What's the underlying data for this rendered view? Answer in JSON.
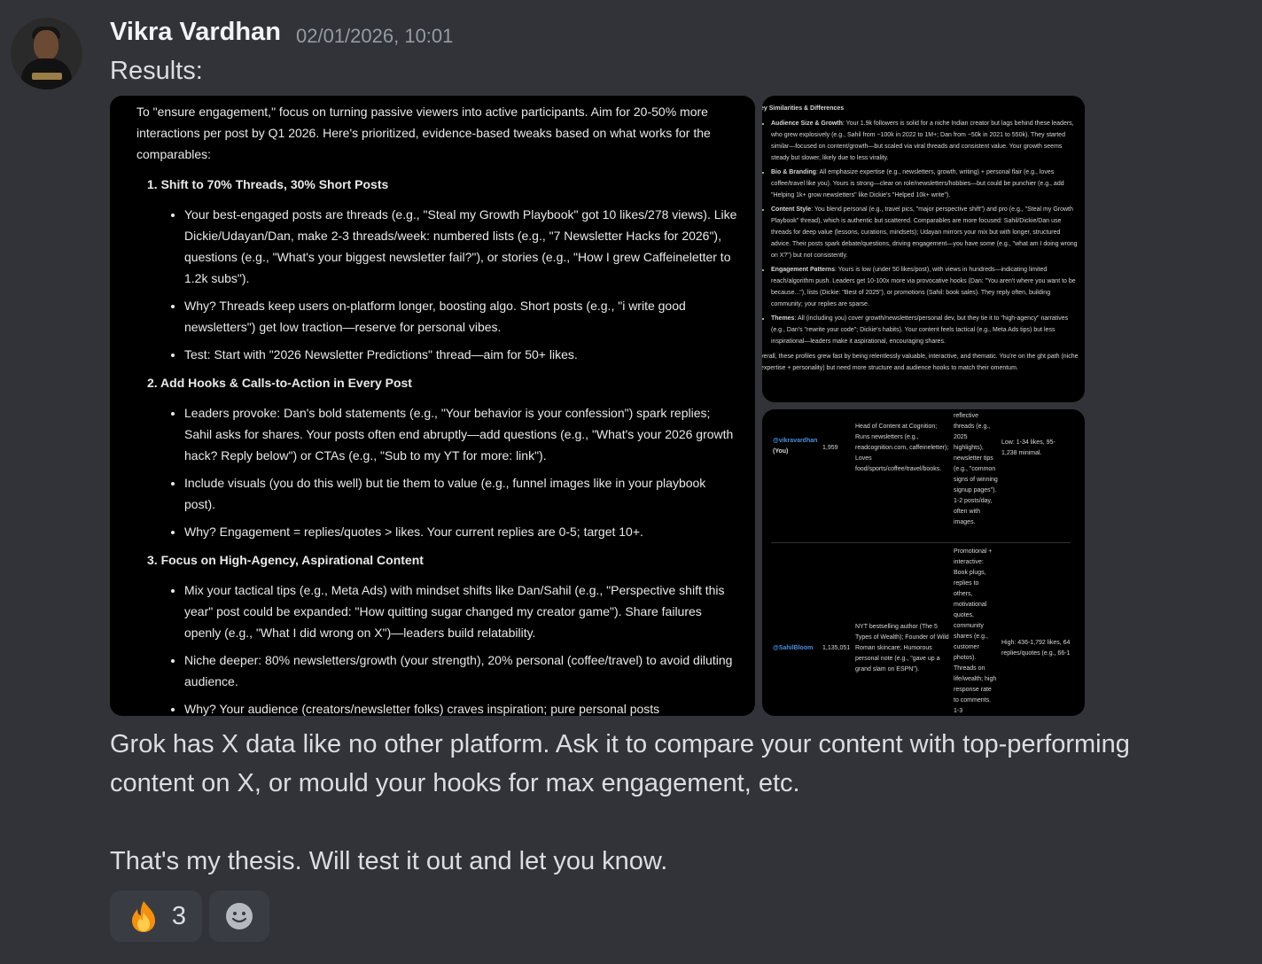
{
  "author": {
    "name": "Vikra Vardhan",
    "timestamp": "02/01/2026, 10:01"
  },
  "message": {
    "intro": "Results:",
    "body_lines": [
      "Grok has X data like no other platform. Ask it to compare your content with top-performing",
      "content on X, or mould your hooks for max engagement, etc.",
      "That's my thesis. Will test it out and let you know."
    ]
  },
  "attachment_main": {
    "intro": "To \"ensure engagement,\" focus on turning passive viewers into active participants. Aim for 20-50% more interactions per post by Q1 2026. Here's prioritized, evidence-based tweaks based on what works for the comparables:",
    "sections": [
      {
        "heading": "1. Shift to 70% Threads, 30% Short Posts",
        "bullets": [
          "Your best-engaged posts are threads (e.g., \"Steal my Growth Playbook\" got 10 likes/278 views). Like Dickie/Udayan/Dan, make 2-3 threads/week: numbered lists (e.g., \"7 Newsletter Hacks for 2026\"), questions (e.g., \"What's your biggest newsletter fail?\"), or stories (e.g., \"How I grew Caffeineletter to 1.2k subs\").",
          "Why? Threads keep users on-platform longer, boosting algo. Short posts (e.g., \"i write good newsletters\") get low traction—reserve for personal vibes.",
          "Test: Start with \"2026 Newsletter Predictions\" thread—aim for 50+ likes."
        ]
      },
      {
        "heading": "2. Add Hooks & Calls-to-Action in Every Post",
        "bullets": [
          "Leaders provoke: Dan's bold statements (e.g., \"Your behavior is your confession\") spark replies; Sahil asks for shares. Your posts often end abruptly—add questions (e.g., \"What's your 2026 growth hack? Reply below\") or CTAs (e.g., \"Sub to my YT for more: link\").",
          "Include visuals (you do this well) but tie them to value (e.g., funnel images like in your playbook post).",
          "Why? Engagement = replies/quotes > likes. Your current replies are 0-5; target 10+."
        ]
      },
      {
        "heading": "3. Focus on High-Agency, Aspirational Content",
        "bullets": [
          "Mix your tactical tips (e.g., Meta Ads) with mindset shifts like Dan/Sahil (e.g., \"Perspective shift this year\" post could be expanded: \"How quitting sugar changed my creator game\"). Share failures openly (e.g., \"What I did wrong on X\")—leaders build relatability.",
          "Niche deeper: 80% newsletters/growth (your strength), 20% personal (coffee/travel) to avoid diluting audience.",
          "Why? Your audience (creators/newsletter folks) craves inspiration; pure personal posts"
        ]
      }
    ]
  },
  "attachment_top": {
    "title": "ey Similarities & Differences",
    "bullets": [
      {
        "label": "Audience Size & Growth",
        "text": ": Your 1.9k followers is solid for a niche Indian creator but lags behind these leaders, who grew explosively (e.g., Sahil from ~100k in 2022 to 1M+; Dan from ~50k in 2021 to 550k). They started similar—focused on content/growth—but scaled via viral threads and consistent value. Your growth seems steady but slower, likely due to less virality."
      },
      {
        "label": "Bio & Branding",
        "text": ": All emphasize expertise (e.g., newsletters, growth, writing) + personal flair (e.g., loves coffee/travel like you). Yours is strong—clear on role/newsletters/hobbies—but could be punchier (e.g., add \"Helping 1k+ grow newsletters\" like Dickie's \"Helped 10k+ write\")."
      },
      {
        "label": "Content Style",
        "text": ": You blend personal (e.g., travel pics, \"major perspective shift\") and pro (e.g., \"Steal my Growth Playbook\" thread), which is authentic but scattered. Comparables are more focused: Sahil/Dickie/Dan use threads for deep value (lessons, curations, mindsets); Udayan mirrors your mix but with longer, structured advice. Their posts spark debate/questions, driving engagement—you have some (e.g., \"what am I doing wrong on X?\") but not consistently."
      },
      {
        "label": "Engagement Patterns",
        "text": ": Yours is low (under 50 likes/post), with views in hundreds—indicating limited reach/algorithm push. Leaders get 10-100x more via provocative hooks (Dan: \"You aren't where you want to be because...\"), lists (Dickie: \"Best of 2025\"), or promotions (Sahil: book sales). They reply often, building community; your replies are sparse."
      },
      {
        "label": "Themes",
        "text": ": All (including you) cover growth/newsletters/personal dev, but they tie it to \"high-agency\" narratives (e.g., Dan's \"rewrite your code\"; Dickie's habits). Your content feels tactical (e.g., Meta Ads tips) but less inspirational—leaders make it aspirational, encouraging shares."
      }
    ],
    "closing": "verall, these profiles grew fast by being relentlessly valuable, interactive, and thematic. You're on the ght path (niche expertise + personality) but need more structure and audience hooks to match their omentum."
  },
  "attachment_bottom": {
    "rows": [
      {
        "handle": "@vikravardhan",
        "you": "(You)",
        "followers": "1,959",
        "bio": "Head of Content at Cognition; Runs newsletters (e.g., readcognition.com, caffeineletter); Loves food/sports/coffee/travel/books.",
        "style": "reflective threads (e.g., 2025 highlights), newsletter tips (e.g., \"common signs of winning signup pages\"). 1-2 posts/day, often with images.",
        "engagement": "Low: 1-34 likes, 95-1,238 minimal."
      },
      {
        "handle": "@SahilBloom",
        "you": "",
        "followers": "1,135,051",
        "bio": "NYT bestselling author (The 5 Types of Wealth); Founder of Wild Roman skincare; Humorous personal note (e.g., \"gave up a grand slam on ESPN\").",
        "style": "Promotional + interactive: Book plugs, replies to others, motivational quotes, community shares (e.g., customer photos). Threads on life/wealth; high response rate to comments. 1-3",
        "engagement": "High: 436-1,792 likes, 64 replies/quotes (e.g., 66-1"
      }
    ]
  },
  "reactions": [
    {
      "emoji": "fire-icon",
      "count": "3"
    },
    {
      "emoji": "add-reaction-icon",
      "count": ""
    }
  ]
}
